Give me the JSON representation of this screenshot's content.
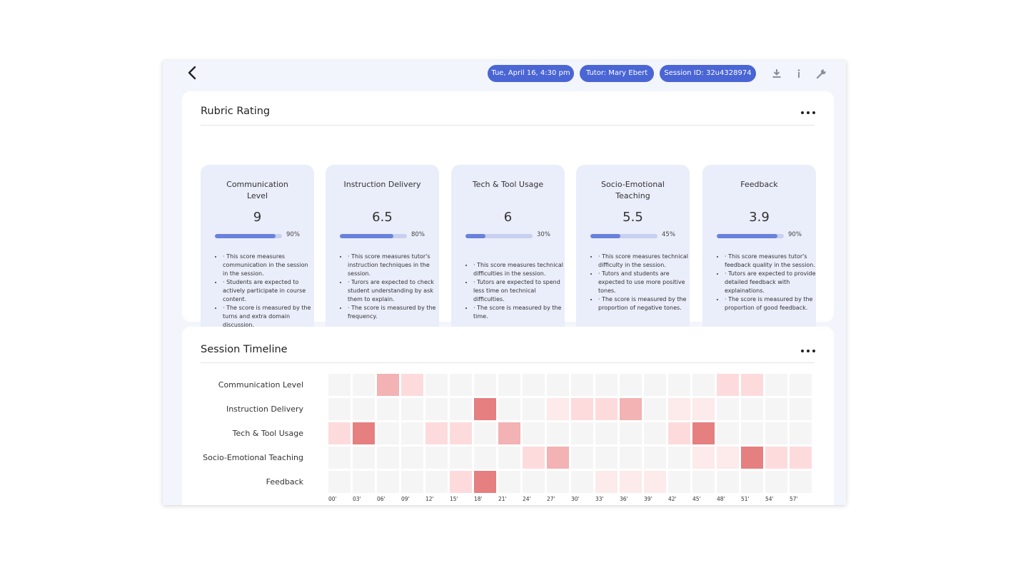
{
  "header": {
    "date_pill": "Tue, April 16, 4:30 pm",
    "tutor_pill": "Tutor: Mary Ebert",
    "session_pill": "Session ID: 32u4328974",
    "icons": [
      "back-arrow-icon",
      "download-icon",
      "info-icon",
      "wrench-icon"
    ]
  },
  "rubric": {
    "title": "Rubric Rating",
    "cards": [
      {
        "title_lines": [
          "Communication",
          "Level"
        ],
        "score": "9",
        "percent_text": "90%",
        "percent": 90,
        "bullets": [
          "· This score measures communication in the session in the session.",
          "· Students are expected to actively participate in course content.",
          "· The score is measured by the turns and extra domain discussion."
        ]
      },
      {
        "title_lines": [
          "Instruction Delivery"
        ],
        "score": "6.5",
        "percent_text": "80%",
        "percent": 80,
        "bullets": [
          "· This score measures tutor's instruction techniques in the session.",
          "· Turors are expected to check student understanding by ask them to explain.",
          "· The score is measured by the frequency."
        ]
      },
      {
        "title_lines": [
          "Tech & Tool Usage"
        ],
        "score": "6",
        "percent_text": "30%",
        "percent": 30,
        "bullets": [
          "· This score measures technical difficulties in the session.",
          "· Tutors are expected to spend less time on technical difficulties.",
          "· The score is measured by the time."
        ]
      },
      {
        "title_lines": [
          "Socio-Emotional",
          "Teaching"
        ],
        "score": "5.5",
        "percent_text": "45%",
        "percent": 45,
        "bullets": [
          "· This score measures technical difficulty in the session.",
          "· Tutors and students are expected to use more positive tones.",
          "· The score is measured by the proportion of negative tones."
        ]
      },
      {
        "title_lines": [
          "Feedback"
        ],
        "score": "3.9",
        "percent_text": "90%",
        "percent": 90,
        "bullets": [
          "· This score measures tutor's feedback quality in the session.",
          "· Tutors are expected to provide detailed feedback with explainations.",
          "· The score is measured by the proportion of good feedback."
        ]
      }
    ]
  },
  "timeline": {
    "title": "Session Timeline",
    "chart_data": {
      "type": "heatmap",
      "rows": [
        "Communication Level",
        "Instruction Delivery",
        "Tech & Tool Usage",
        "Socio-Emotional Teaching",
        "Feedback"
      ],
      "columns": [
        "00'",
        "03'",
        "06'",
        "09'",
        "12'",
        "15'",
        "18'",
        "21'",
        "24'",
        "27'",
        "30'",
        "33'",
        "36'",
        "39'",
        "42'",
        "45'",
        "48'",
        "51'",
        "54'",
        "57'"
      ],
      "values": [
        [
          0,
          0,
          2,
          1,
          0,
          0,
          0,
          0,
          0,
          0,
          0,
          0,
          0,
          0,
          0,
          0,
          1,
          1,
          0,
          0
        ],
        [
          0,
          0,
          0,
          0,
          0,
          0,
          4,
          0,
          0,
          0.5,
          1,
          1,
          2,
          0,
          0.5,
          0.5,
          0,
          0,
          0,
          0
        ],
        [
          1,
          4,
          0,
          0,
          1,
          1,
          0,
          2,
          0,
          0,
          0,
          0,
          0,
          0,
          1,
          4,
          0,
          0,
          0,
          0
        ],
        [
          0,
          0,
          0,
          0,
          0,
          0,
          0,
          0,
          1,
          2,
          0,
          0,
          0,
          0,
          0,
          0.5,
          0.5,
          4,
          1,
          1
        ],
        [
          0,
          0,
          0,
          0,
          0,
          1,
          4,
          0,
          0,
          0,
          0,
          0.5,
          0.5,
          0.5,
          0,
          0,
          0,
          0,
          0,
          0
        ]
      ],
      "color_scale": {
        "0": "#f5f5f5",
        "0.5": "#fdeaea",
        "1": "#fddbdc",
        "2": "#f3b2b3",
        "4": "#e57f80"
      }
    }
  }
}
